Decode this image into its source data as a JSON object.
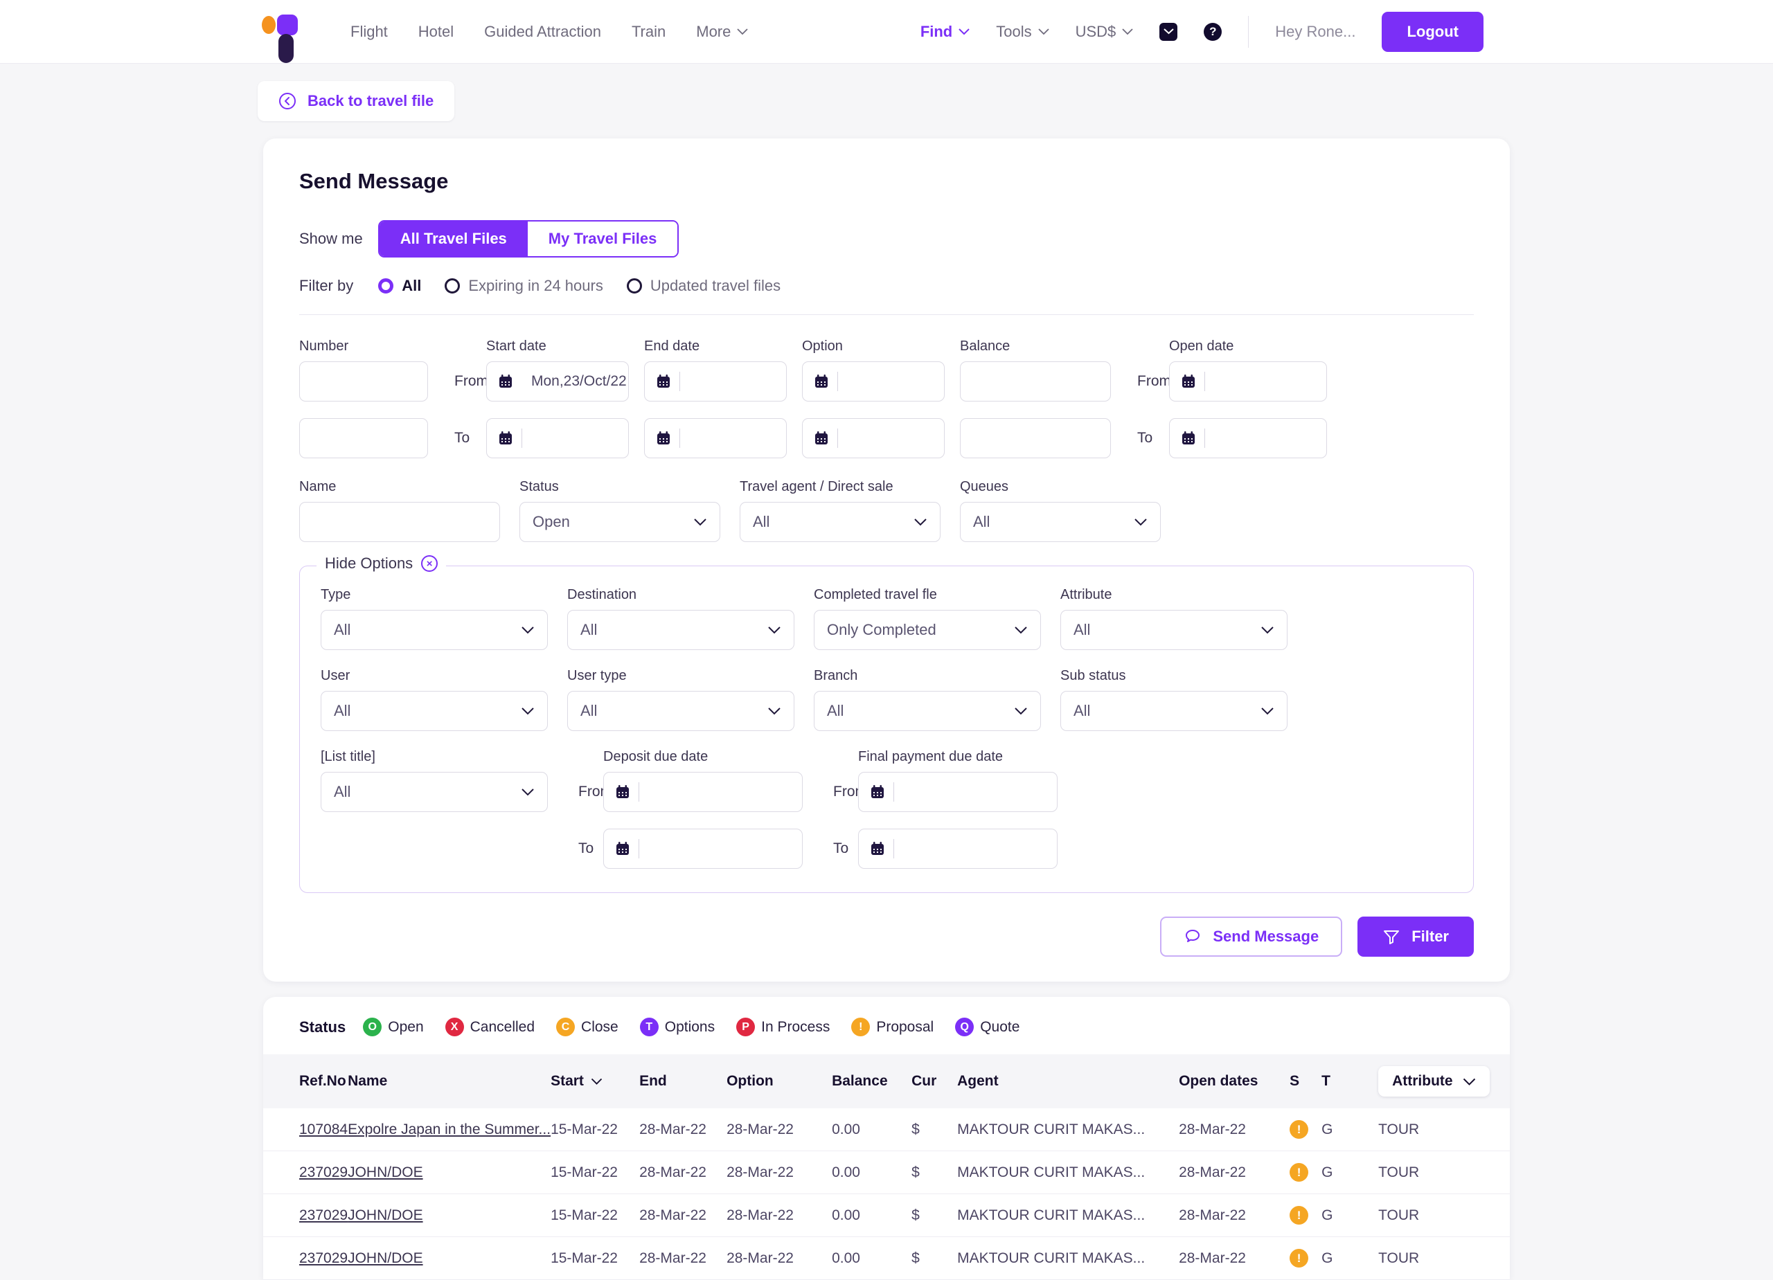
{
  "nav": {
    "links": [
      {
        "label": "Flight",
        "caret": false
      },
      {
        "label": "Hotel",
        "caret": false
      },
      {
        "label": "Guided Attraction",
        "caret": false
      },
      {
        "label": "Train",
        "caret": false
      },
      {
        "label": "More",
        "caret": true
      }
    ],
    "right": [
      {
        "label": "Find",
        "caret": true,
        "accent": true
      },
      {
        "label": "Tools",
        "caret": true,
        "accent": false
      },
      {
        "label": "USD$",
        "caret": true,
        "accent": false
      }
    ],
    "mail_icon": "mail-icon",
    "help_icon": "help-icon",
    "help_glyph": "?",
    "greeting": "Hey Rone...",
    "logout_label": "Logout"
  },
  "back_button": {
    "label": "Back to travel file",
    "icon": "arrow-left-circle-icon"
  },
  "page": {
    "title": "Send Message",
    "show_me_label": "Show me",
    "show_me_options": [
      {
        "label": "All Travel Files",
        "active": true
      },
      {
        "label": "My Travel Files",
        "active": false
      }
    ],
    "filter_by_label": "Filter by",
    "filter_by_options": [
      {
        "label": "All",
        "checked": true
      },
      {
        "label": "Expiring in 24 hours",
        "checked": false
      },
      {
        "label": "Updated travel files",
        "checked": false
      }
    ]
  },
  "filters": {
    "number": {
      "label": "Number",
      "from_value": "",
      "to_value": ""
    },
    "start_date": {
      "label": "Start date",
      "from_label": "From",
      "to_label": "To",
      "from_value": "Mon,23/Oct/22",
      "to_value": ""
    },
    "end_date": {
      "label": "End date",
      "from_value": "",
      "to_value": ""
    },
    "option": {
      "label": "Option",
      "from_value": "",
      "to_value": ""
    },
    "balance": {
      "label": "Balance",
      "from_value": "",
      "to_value": ""
    },
    "open_date": {
      "label": "Open date",
      "from_label": "From",
      "to_label": "To",
      "from_value": "",
      "to_value": ""
    },
    "name": {
      "label": "Name",
      "value": ""
    },
    "status": {
      "label": "Status",
      "value": "Open"
    },
    "travel_agent": {
      "label": "Travel agent / Direct sale",
      "value": "All"
    },
    "queues": {
      "label": "Queues",
      "value": "All"
    }
  },
  "options_panel": {
    "legend": "Hide Options",
    "close_icon": "close-circle-icon",
    "close_glyph": "×",
    "type": {
      "label": "Type",
      "value": "All"
    },
    "destination": {
      "label": "Destination",
      "value": "All"
    },
    "completed_travel_file": {
      "label": "Completed travel fle",
      "value": "Only Completed"
    },
    "attribute": {
      "label": "Attribute",
      "value": "All"
    },
    "user": {
      "label": "User",
      "value": "All"
    },
    "user_type": {
      "label": "User type",
      "value": "All"
    },
    "branch": {
      "label": "Branch",
      "value": "All"
    },
    "sub_status": {
      "label": "Sub status",
      "value": "All"
    },
    "list_title": {
      "label": "[List title]",
      "value": "All"
    },
    "deposit_due_date": {
      "label": "Deposit due date",
      "from_label": "From",
      "to_label": "To",
      "from_value": "",
      "to_value": ""
    },
    "final_payment_due_date": {
      "label": "Final payment due date",
      "from_label": "From",
      "to_label": "To",
      "from_value": "",
      "to_value": ""
    }
  },
  "actions": {
    "send_message_label": "Send Message",
    "send_message_icon": "chat-bubble-icon",
    "filter_label": "Filter",
    "filter_icon": "funnel-icon"
  },
  "results": {
    "status_legend_title": "Status",
    "status_legend": [
      {
        "glyph": "O",
        "label": "Open",
        "color": "#2BB24C"
      },
      {
        "glyph": "X",
        "label": "Cancelled",
        "color": "#E02841"
      },
      {
        "glyph": "C",
        "label": "Close",
        "color": "#F5A623"
      },
      {
        "glyph": "T",
        "label": "Options",
        "color": "#7B2FF7"
      },
      {
        "glyph": "P",
        "label": "In Process",
        "color": "#E02841"
      },
      {
        "glyph": "!",
        "label": "Proposal",
        "color": "#F5A623"
      },
      {
        "glyph": "Q",
        "label": "Quote",
        "color": "#7B2FF7"
      }
    ],
    "columns": [
      {
        "key": "ref",
        "label": "Ref.No",
        "sort": false
      },
      {
        "key": "name",
        "label": "Name",
        "sort": false
      },
      {
        "key": "start",
        "label": "Start",
        "sort": true
      },
      {
        "key": "end",
        "label": "End",
        "sort": false
      },
      {
        "key": "option",
        "label": "Option",
        "sort": false
      },
      {
        "key": "balance",
        "label": "Balance",
        "sort": false
      },
      {
        "key": "cur",
        "label": "Cur",
        "sort": false
      },
      {
        "key": "agent",
        "label": "Agent",
        "sort": false
      },
      {
        "key": "open_dates",
        "label": "Open dates",
        "sort": false
      },
      {
        "key": "s",
        "label": "S",
        "sort": false
      },
      {
        "key": "t",
        "label": "T",
        "sort": false
      }
    ],
    "attribute_filter": {
      "label": "Attribute",
      "icon": "chevron-down-icon"
    },
    "sort_icon": "chevron-down-icon",
    "rows": [
      {
        "ref": "107084",
        "name": "Expolre Japan in the Summer...",
        "start": "15-Mar-22",
        "end": "28-Mar-22",
        "option": "28-Mar-22",
        "balance": "0.00",
        "cur": "$",
        "agent": "MAKTOUR CURIT MAKAS...",
        "open_dates": "28-Mar-22",
        "s_glyph": "!",
        "s_color": "#F5A623",
        "t": "G",
        "attribute": "TOUR"
      },
      {
        "ref": "237029",
        "name": "JOHN/DOE",
        "start": "15-Mar-22",
        "end": "28-Mar-22",
        "option": "28-Mar-22",
        "balance": "0.00",
        "cur": "$",
        "agent": "MAKTOUR CURIT MAKAS...",
        "open_dates": "28-Mar-22",
        "s_glyph": "!",
        "s_color": "#F5A623",
        "t": "G",
        "attribute": "TOUR"
      },
      {
        "ref": "237029",
        "name": "JOHN/DOE",
        "start": "15-Mar-22",
        "end": "28-Mar-22",
        "option": "28-Mar-22",
        "balance": "0.00",
        "cur": "$",
        "agent": "MAKTOUR CURIT MAKAS...",
        "open_dates": "28-Mar-22",
        "s_glyph": "!",
        "s_color": "#F5A623",
        "t": "G",
        "attribute": "TOUR"
      },
      {
        "ref": "237029",
        "name": "JOHN/DOE",
        "start": "15-Mar-22",
        "end": "28-Mar-22",
        "option": "28-Mar-22",
        "balance": "0.00",
        "cur": "$",
        "agent": "MAKTOUR CURIT MAKAS...",
        "open_dates": "28-Mar-22",
        "s_glyph": "!",
        "s_color": "#F5A623",
        "t": "G",
        "attribute": "TOUR"
      }
    ]
  },
  "colors": {
    "accent": "#7B2FF7",
    "orange": "#F5A623",
    "red": "#E02841",
    "green": "#2BB24C",
    "dark": "#17102e"
  }
}
